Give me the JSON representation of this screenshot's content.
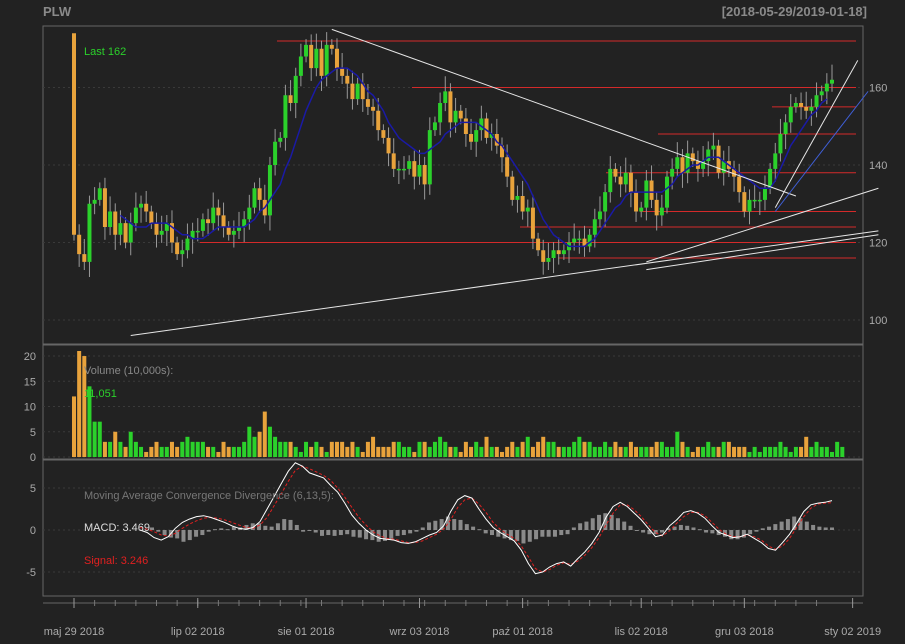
{
  "header": {
    "symbol": "PLW",
    "date_range": "[2018-05-29/2019-01-18]"
  },
  "chart_data": [
    {
      "type": "candlestick",
      "panel": "price",
      "ylim": [
        94,
        176
      ],
      "yticks": [
        100,
        120,
        140,
        160
      ],
      "last_label": "Last 162",
      "colors": {
        "up": "#2bd12b",
        "down": "#e8a33c",
        "wick": "#999999",
        "sma": "#1a1aa6",
        "levels": "#d42a2a",
        "trend": "#e6e6e6",
        "trend_blue": "#3f5fd8",
        "grid": "#3a3a3a",
        "label_green": "#2bd12b"
      },
      "xticks": [
        "maj 29 2018",
        "lip 02 2018",
        "sie 01 2018",
        "wrz 03 2018",
        "paź 01 2018",
        "lis 02 2018",
        "gru 03 2018",
        "sty 02 2019"
      ],
      "xtick_index": [
        0,
        24,
        45,
        67,
        87,
        110,
        130,
        151
      ],
      "ohlc_note": "open/close per session",
      "opens": [
        147,
        122,
        117,
        115,
        130,
        131,
        134,
        124,
        128,
        122,
        125,
        120,
        125,
        129,
        130,
        128,
        125,
        122,
        123,
        125,
        120,
        117,
        118,
        121,
        123,
        123,
        126,
        125,
        129,
        127,
        124,
        122,
        123,
        124,
        126,
        129,
        134,
        131,
        127,
        140,
        146,
        147,
        158,
        156,
        163,
        168,
        171,
        165,
        170,
        163,
        171,
        170,
        165,
        163,
        161,
        157,
        161,
        157,
        155,
        154,
        149,
        147,
        143,
        139,
        139,
        139,
        141,
        137,
        140,
        135,
        149,
        151,
        156,
        159,
        151,
        154,
        152,
        148,
        146,
        149,
        152,
        147,
        148,
        145,
        142,
        137,
        131,
        132,
        128,
        129,
        121,
        118,
        115,
        116,
        118,
        117,
        118,
        120,
        121,
        121,
        119,
        122,
        126,
        128,
        133,
        139,
        137,
        135,
        138,
        133,
        128,
        129,
        136,
        131,
        127,
        129,
        137,
        139,
        142,
        138,
        143,
        141,
        139,
        141,
        144,
        145,
        138,
        141,
        139,
        137,
        133,
        128,
        131,
        131,
        131,
        134,
        139,
        143,
        148,
        151,
        155,
        156,
        155,
        154,
        155,
        158,
        159,
        161
      ],
      "closes": [
        122,
        117,
        115,
        130,
        131,
        134,
        124,
        128,
        122,
        125,
        120,
        125,
        129,
        130,
        128,
        125,
        122,
        123,
        125,
        120,
        117,
        118,
        121,
        123,
        123,
        126,
        125,
        129,
        127,
        124,
        122,
        123,
        124,
        126,
        129,
        134,
        131,
        127,
        140,
        146,
        147,
        158,
        156,
        163,
        168,
        171,
        165,
        170,
        163,
        171,
        170,
        165,
        163,
        161,
        157,
        161,
        157,
        155,
        154,
        149,
        147,
        143,
        139,
        139,
        139,
        141,
        137,
        140,
        135,
        149,
        151,
        156,
        159,
        151,
        154,
        152,
        148,
        146,
        149,
        152,
        147,
        148,
        145,
        142,
        137,
        131,
        132,
        128,
        129,
        121,
        118,
        115,
        116,
        118,
        117,
        118,
        120,
        121,
        121,
        119,
        122,
        126,
        128,
        133,
        139,
        137,
        135,
        138,
        133,
        128,
        129,
        136,
        131,
        127,
        129,
        137,
        139,
        142,
        138,
        143,
        141,
        139,
        141,
        144,
        145,
        138,
        141,
        139,
        137,
        133,
        128,
        131,
        131,
        131,
        134,
        139,
        143,
        148,
        151,
        155,
        156,
        155,
        154,
        155,
        158,
        159,
        161,
        162
      ],
      "sma": [
        null,
        null,
        null,
        null,
        null,
        null,
        null,
        null,
        null,
        127,
        126,
        125,
        124,
        124,
        124,
        125,
        125,
        125,
        125,
        124,
        123,
        122,
        122,
        121,
        121,
        121,
        122,
        123,
        124,
        124,
        124,
        124,
        124,
        124,
        125,
        126,
        128,
        129,
        131,
        133,
        135,
        139,
        142,
        146,
        150,
        154,
        157,
        160,
        162,
        163,
        164,
        165,
        165,
        165,
        164,
        163,
        161,
        159,
        158,
        156,
        154,
        151,
        149,
        147,
        146,
        145,
        144,
        143,
        143,
        144,
        145,
        146,
        148,
        149,
        150,
        151,
        151,
        151,
        151,
        150,
        149,
        148,
        146,
        145,
        143,
        141,
        139,
        137,
        135,
        132,
        129,
        126,
        124,
        122,
        121,
        120,
        119,
        119,
        119,
        119,
        120,
        121,
        123,
        125,
        127,
        129,
        130,
        132,
        133,
        133,
        133,
        133,
        133,
        133,
        133,
        134,
        135,
        137,
        138,
        139,
        140,
        140,
        141,
        142,
        142,
        142,
        141,
        140,
        139,
        138,
        137,
        136,
        135,
        134,
        134,
        134,
        136,
        139,
        142,
        145,
        147,
        149,
        151,
        153,
        154,
        156,
        157
      ],
      "levels": [
        172,
        160,
        155,
        148,
        138,
        128,
        124,
        120,
        116
      ],
      "trendlines": [
        {
          "from": [
            11,
            96
          ],
          "to": [
            156,
            123
          ]
        },
        {
          "from": [
            111,
            115
          ],
          "to": [
            156,
            134
          ]
        },
        {
          "from": [
            111,
            113
          ],
          "to": [
            156,
            122
          ]
        },
        {
          "from": [
            50,
            175
          ],
          "to": [
            140,
            132
          ]
        },
        {
          "from": [
            136,
            129
          ],
          "to": [
            152,
            167
          ]
        },
        {
          "from": [
            136,
            128
          ],
          "to": [
            154,
            159
          ]
        }
      ]
    },
    {
      "type": "bar",
      "panel": "volume",
      "label": "Volume (10,000s):",
      "last_value": "11,051",
      "ylim": [
        0,
        22
      ],
      "yticks": [
        0,
        5,
        10,
        15,
        20
      ],
      "values": [
        12,
        21,
        20,
        14,
        7,
        7,
        3,
        3,
        5,
        3,
        2,
        5,
        3,
        2,
        1,
        2,
        3,
        2,
        2,
        3,
        2,
        3,
        4,
        3,
        3,
        3,
        2,
        2,
        1,
        3,
        2,
        2,
        2,
        3,
        6,
        4,
        5,
        9,
        6,
        4,
        3,
        3,
        3,
        2,
        1,
        3,
        2,
        3,
        2,
        1,
        3,
        3,
        3,
        2,
        3,
        2,
        1,
        3,
        4,
        2,
        2,
        2,
        3,
        3,
        2,
        2,
        1,
        3,
        3,
        2,
        3,
        4,
        3,
        2,
        2,
        1,
        3,
        2,
        3,
        2,
        4,
        2,
        2,
        1,
        2,
        3,
        2,
        3,
        4,
        2,
        3,
        4,
        3,
        3,
        2,
        2,
        2,
        3,
        4,
        3,
        3,
        2,
        2,
        3,
        2,
        3,
        2,
        2,
        3,
        2,
        2,
        2,
        2,
        3,
        3,
        2,
        2,
        5,
        3,
        2,
        1,
        2,
        2,
        3,
        2,
        2,
        3,
        3,
        2,
        2,
        2,
        1,
        2,
        1,
        2,
        2,
        2,
        3,
        2,
        1,
        2,
        2,
        4,
        2,
        3,
        2,
        2,
        1,
        3,
        2
      ]
    },
    {
      "type": "line",
      "panel": "macd",
      "title": "Moving Average Convergence Divergence (6,13,5):",
      "macd_label": "MACD: 3.469",
      "signal_label": "Signal: 3.246",
      "ylim": [
        -7.5,
        8
      ],
      "yticks": [
        -5,
        0,
        5
      ],
      "macd": [
        0,
        -0.3,
        -0.9,
        -1.2,
        -0.8,
        0.2,
        0.9,
        1.3,
        1.6,
        1.7,
        1.5,
        1.2,
        0.9,
        0.5,
        0.2,
        0.1,
        0.3,
        1.0,
        2.5,
        4.0,
        5.5,
        7.0,
        8.0,
        7.6,
        6.8,
        6.5,
        6.2,
        5.3,
        4.5,
        3.2,
        1.8,
        0.8,
        0,
        -0.6,
        -1.0,
        -1.1,
        -1.2,
        -1.5,
        -1.6,
        -1.4,
        -1.0,
        -0.6,
        -0.3,
        0.5,
        2.2,
        3.6,
        4.1,
        3.8,
        2.5,
        1.3,
        0.3,
        -0.3,
        -0.8,
        -1.3,
        -2.4,
        -4.0,
        -5.2,
        -5.0,
        -4.4,
        -4.0,
        -3.8,
        -4.3,
        -3.4,
        -2.6,
        -1.6,
        -0.3,
        1.5,
        2.8,
        3.3,
        2.8,
        2.0,
        1.2,
        0.2,
        -0.8,
        -0.6,
        0.5,
        1.2,
        2.1,
        2.3,
        2.0,
        1.4,
        0.5,
        -0.3,
        -0.6,
        -0.9,
        -0.8,
        -0.5,
        -1.0,
        -1.5,
        -2.2,
        -2.4,
        -1.5,
        -0.5,
        0.8,
        2.2,
        3.0,
        3.2,
        3.3,
        3.5
      ],
      "signal": [
        0.3,
        0.1,
        -0.2,
        -0.6,
        -0.7,
        -0.4,
        0.2,
        0.7,
        1.1,
        1.4,
        1.5,
        1.4,
        1.2,
        0.9,
        0.6,
        0.3,
        0.2,
        0.6,
        1.5,
        2.9,
        4.3,
        5.8,
        7.1,
        7.6,
        7.3,
        6.9,
        6.5,
        5.9,
        5.0,
        3.9,
        2.7,
        1.5,
        0.6,
        -0.2,
        -0.7,
        -1.0,
        -1.1,
        -1.3,
        -1.5,
        -1.5,
        -1.3,
        -0.9,
        -0.5,
        0.1,
        1.2,
        2.7,
        3.6,
        3.8,
        3.1,
        2.1,
        0.9,
        0.1,
        -0.5,
        -1.0,
        -1.9,
        -3.2,
        -4.6,
        -5.0,
        -4.7,
        -4.2,
        -3.9,
        -4.1,
        -3.7,
        -3.0,
        -2.1,
        -0.9,
        0.6,
        2.0,
        3.0,
        3.0,
        2.4,
        1.6,
        0.6,
        -0.3,
        -0.7,
        -0.1,
        0.8,
        1.6,
        2.1,
        2.1,
        1.7,
        0.9,
        0.1,
        -0.5,
        -0.8,
        -0.8,
        -0.6,
        -0.8,
        -1.2,
        -1.9,
        -2.3,
        -1.9,
        -1.0,
        0.3,
        1.6,
        2.6,
        3.1,
        3.2,
        3.25
      ],
      "histogram": [
        0.3,
        -0.2,
        -0.6,
        -0.9,
        -1.0,
        -1.4,
        -1.2,
        -0.8,
        -0.6,
        -0.2,
        0.1,
        0.2,
        0.1,
        0.4,
        0.3,
        0.6,
        0.8,
        0.8,
        0.5,
        0.4,
        0.8,
        1.3,
        1.2,
        0.6,
        -0.2,
        -0.1,
        -0.3,
        -0.7,
        -0.6,
        -0.7,
        -0.6,
        -0.5,
        -0.8,
        -0.9,
        -1.1,
        -1.2,
        -1.4,
        -1.3,
        -1.1,
        -0.7,
        -0.6,
        -0.4,
        -0.2,
        0.3,
        0.9,
        1.1,
        1.3,
        1.6,
        1.3,
        1.2,
        0.7,
        0.4,
        0.1,
        -0.4,
        -0.6,
        -0.8,
        -1.0,
        -1.2,
        -1.3,
        -1.6,
        -1.4,
        -1.1,
        -0.8,
        -0.8,
        -0.8,
        -0.6,
        -0.5,
        0.3,
        0.8,
        1.0,
        1.4,
        1.8,
        2.0,
        1.8,
        1.4,
        1.0,
        0.5,
        0,
        -0.3,
        -0.5,
        -0.5,
        -0.3,
        0.2,
        0.4,
        0.6,
        0.5,
        0.3,
        0.1,
        -0.3,
        -0.4,
        -0.6,
        -0.8,
        -1.1,
        -1.1,
        -0.9,
        -0.5,
        -0.2,
        0.2,
        0.4,
        0.7,
        1.0,
        1.3,
        1.6,
        1.4,
        1.0,
        0.6,
        0.4,
        0.3,
        0.3
      ]
    }
  ]
}
